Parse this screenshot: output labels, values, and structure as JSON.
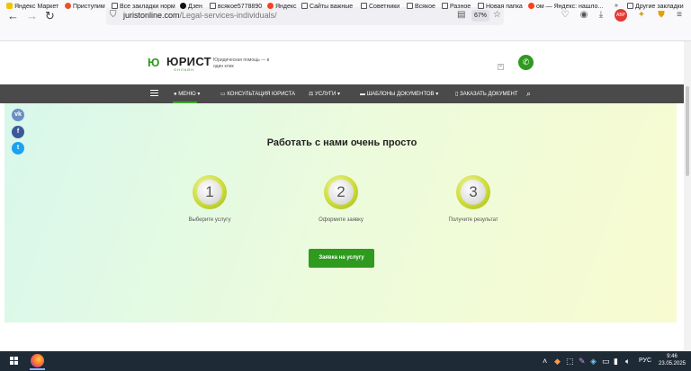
{
  "browser": {
    "url_domain": "juristonline.com",
    "url_path": "/Legal-services-individuals/",
    "zoom": "67%",
    "bookmarks": [
      "Яндекс Маркет",
      "Приступим",
      "Все закладки норм",
      "Дзен",
      "всякое5778890",
      "Яндекс",
      "Сайты важные",
      "Советники",
      "Всякое",
      "Разное",
      "Новая папка",
      "ом — Яндекс: нашло...",
      "»",
      "Другие закладки"
    ]
  },
  "header": {
    "logo_mark": "Ю",
    "logo_text": "ЮРИСТ",
    "logo_sub": "ОНЛАЙН",
    "tagline": "Юридическая помощь — в один клик",
    "ad_close": "✕"
  },
  "nav": {
    "items": [
      "МЕНЮ",
      "КОНСУЛЬТАЦИЯ ЮРИСТА",
      "УСЛУГИ",
      "ШАБЛОНЫ ДОКУМЕНТОВ",
      "ЗАКАЗАТЬ ДОКУМЕНТ"
    ]
  },
  "social": [
    {
      "label": "vk",
      "color": "#6b8fc2"
    },
    {
      "label": "f",
      "color": "#3b5998"
    },
    {
      "label": "t",
      "color": "#1da1f2"
    }
  ],
  "main": {
    "headline": "Работать с нами очень просто",
    "steps": [
      {
        "number": "1",
        "label": "Выберите услугу"
      },
      {
        "number": "2",
        "label": "Оформите заявку"
      },
      {
        "number": "3",
        "label": "Получите результат"
      }
    ],
    "cta": "Заявка на услугу"
  },
  "taskbar": {
    "lang": "РУС",
    "time": "9:46",
    "date": "23.05.2025"
  },
  "colors": {
    "brand_green": "#2e9a1e",
    "nav_bg": "#4a4a4a",
    "taskbar_bg": "#1f2a37"
  }
}
